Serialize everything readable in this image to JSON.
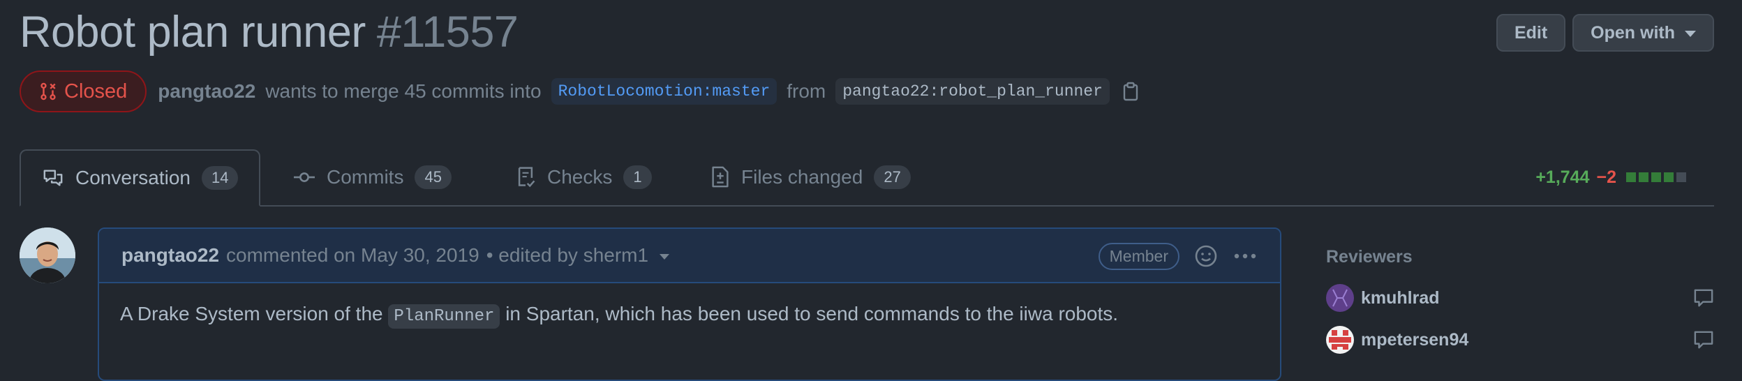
{
  "header": {
    "title": "Robot plan runner",
    "number": "#11557",
    "edit_label": "Edit",
    "open_with_label": "Open with"
  },
  "meta": {
    "state": "Closed",
    "author": "pangtao22",
    "wants_text": "wants to merge 45 commits into",
    "base_branch": "RobotLocomotion:master",
    "from_text": "from",
    "head_branch": "pangtao22:robot_plan_runner"
  },
  "tabs": [
    {
      "label": "Conversation",
      "count": "14"
    },
    {
      "label": "Commits",
      "count": "45"
    },
    {
      "label": "Checks",
      "count": "1"
    },
    {
      "label": "Files changed",
      "count": "27"
    }
  ],
  "diffstat": {
    "additions": "+1,744",
    "deletions": "−2",
    "add_color": "#57ab5a",
    "del_color": "#e5534b"
  },
  "comment": {
    "author": "pangtao22",
    "action": "commented on May 30, 2019",
    "edited": "• edited by sherm1",
    "role": "Member",
    "body_prefix": "A Drake System version of the",
    "body_code": "PlanRunner",
    "body_suffix": "in Spartan, which has been used to send commands to the iiwa robots."
  },
  "sidebar": {
    "reviewers_heading": "Reviewers",
    "reviewers": [
      {
        "name": "kmuhlrad"
      },
      {
        "name": "mpetersen94"
      }
    ]
  },
  "colors": {
    "background": "#22272e",
    "closed_red": "#e5534b",
    "link_blue": "#539bf5"
  }
}
